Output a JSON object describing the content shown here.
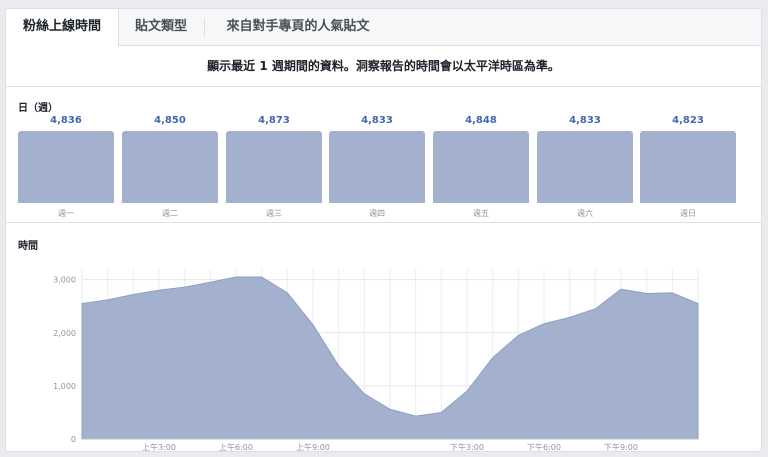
{
  "tabs": [
    {
      "label": "粉絲上線時間",
      "active": true
    },
    {
      "label": "貼文類型",
      "active": false
    },
    {
      "label": "來自對手專頁的人氣貼文",
      "active": false
    }
  ],
  "notice": "顯示最近 1 週期間的資料。洞察報告的時間會以太平洋時區為準。",
  "days_section": {
    "label": "日（週）",
    "days": [
      {
        "label": "週一",
        "value": "4,836"
      },
      {
        "label": "週二",
        "value": "4,850"
      },
      {
        "label": "週三",
        "value": "4,873"
      },
      {
        "label": "週四",
        "value": "4,833"
      },
      {
        "label": "週五",
        "value": "4,848"
      },
      {
        "label": "週六",
        "value": "4,833"
      },
      {
        "label": "週日",
        "value": "4,823"
      }
    ]
  },
  "hours_section": {
    "label": "時間"
  },
  "colors": {
    "bar": "#a3b1cf",
    "value_text": "#4267b2",
    "area_fill": "#a3b1cf",
    "area_stroke": "#8d9fc4"
  },
  "chart_data": [
    {
      "type": "bar",
      "categories": [
        "週一",
        "週二",
        "週三",
        "週四",
        "週五",
        "週六",
        "週日"
      ],
      "values": [
        4836,
        4850,
        4873,
        4833,
        4848,
        4833,
        4823
      ],
      "title": "日（週）"
    },
    {
      "type": "area",
      "title": "時間",
      "x": [
        0,
        1,
        2,
        3,
        4,
        5,
        6,
        7,
        8,
        9,
        10,
        11,
        12,
        13,
        14,
        15,
        16,
        17,
        18,
        19,
        20,
        21,
        22,
        23
      ],
      "values": [
        2550,
        2620,
        2720,
        2800,
        2860,
        2950,
        3050,
        3050,
        2750,
        2150,
        1380,
        850,
        560,
        430,
        500,
        900,
        1530,
        1950,
        2170,
        2290,
        2450,
        2820,
        2740,
        2750,
        2550
      ],
      "y_ticks": [
        "0",
        "1,000",
        "2,000",
        "3,000"
      ],
      "y_tick_values": [
        0,
        1000,
        2000,
        3000
      ],
      "x_tick_labels": [
        {
          "hour": 3,
          "label": "上午3:00"
        },
        {
          "hour": 6,
          "label": "上午6:00"
        },
        {
          "hour": 9,
          "label": "上午9:00"
        },
        {
          "hour": 15,
          "label": "下午3:00"
        },
        {
          "hour": 18,
          "label": "下午6:00"
        },
        {
          "hour": 21,
          "label": "下午9:00"
        }
      ],
      "ylim": [
        0,
        3200
      ],
      "grid": true
    }
  ]
}
